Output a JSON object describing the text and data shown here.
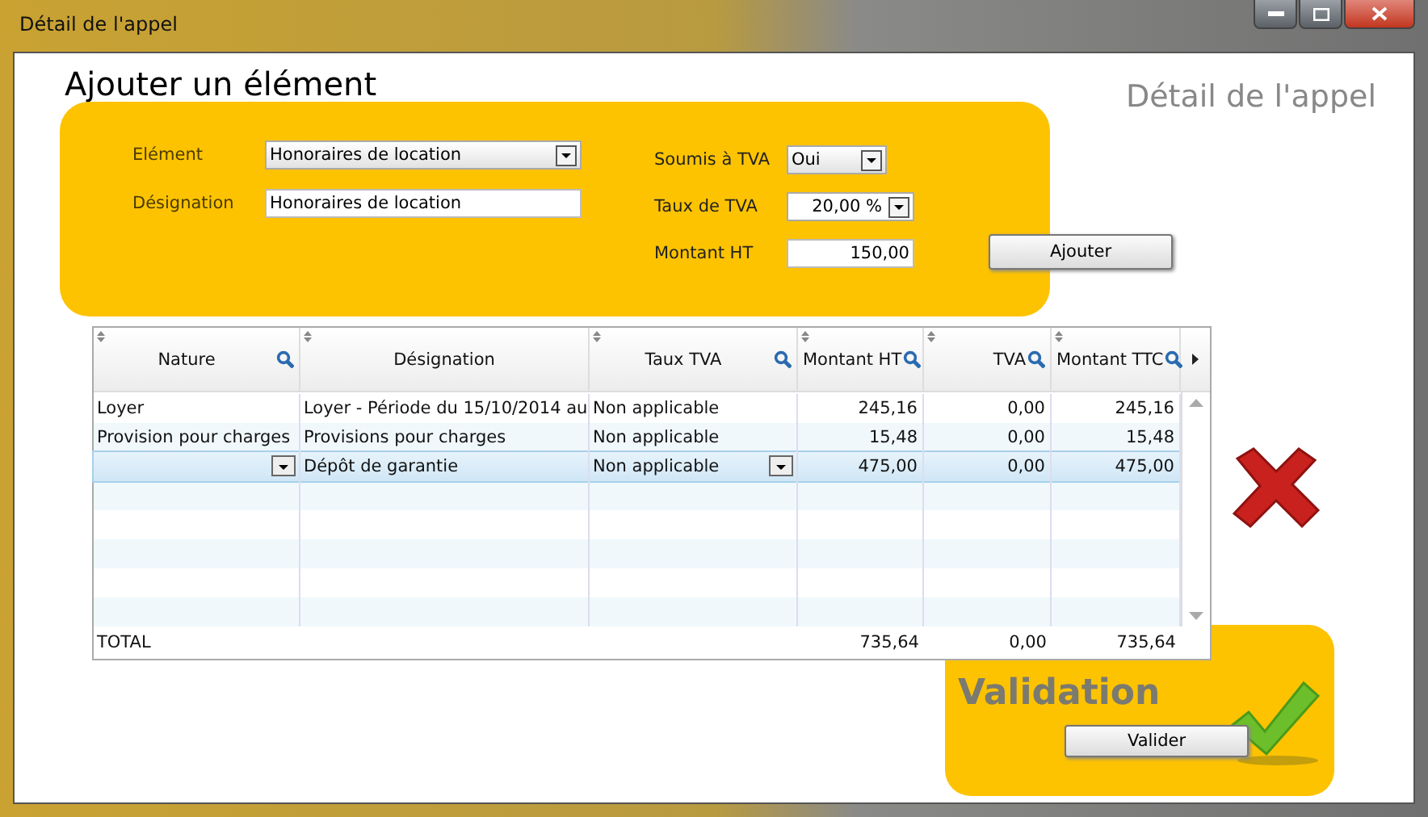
{
  "window": {
    "title": "Détail de l'appel"
  },
  "header": {
    "title": "Détail de l'appel"
  },
  "add_panel": {
    "title": "Ajouter un élément",
    "left_fields": [
      {
        "label": "Elément",
        "kind": "select",
        "value": "Honoraires de location"
      },
      {
        "label": "Désignation",
        "kind": "text",
        "value": "Honoraires de location"
      }
    ],
    "right_fields": [
      {
        "label": "Soumis à TVA",
        "kind": "select",
        "value": "Oui"
      },
      {
        "label": "Taux de TVA",
        "kind": "select-number",
        "value": "20,00 %"
      },
      {
        "label": "Montant HT",
        "kind": "number",
        "value": "150,00"
      }
    ],
    "button": "Ajouter"
  },
  "table": {
    "columns": [
      {
        "label": "Nature",
        "filter": true,
        "kind": "text"
      },
      {
        "label": "Désignation",
        "filter": false,
        "kind": "text"
      },
      {
        "label": "Taux TVA",
        "filter": true,
        "kind": "text"
      },
      {
        "label": "Montant HT",
        "filter": true,
        "kind": "amount"
      },
      {
        "label": "TVA",
        "filter": true,
        "kind": "amount"
      },
      {
        "label": "Montant TTC",
        "filter": true,
        "kind": "amount"
      }
    ],
    "rows": [
      {
        "selected": false,
        "cells": [
          "Loyer",
          "Loyer - Période du 15/10/2014 au",
          "Non applicable",
          "245,16",
          "0,00",
          "245,16"
        ]
      },
      {
        "selected": false,
        "cells": [
          "Provision pour charges",
          "Provisions pour charges",
          "Non applicable",
          "15,48",
          "0,00",
          "15,48"
        ]
      },
      {
        "selected": true,
        "cells": [
          "",
          "Dépôt de garantie",
          "Non applicable",
          "475,00",
          "0,00",
          "475,00"
        ]
      }
    ],
    "total": {
      "label": "TOTAL",
      "amounts": [
        "735,64",
        "0,00",
        "735,64"
      ]
    }
  },
  "validation": {
    "title": "Validation",
    "button": "Valider"
  }
}
